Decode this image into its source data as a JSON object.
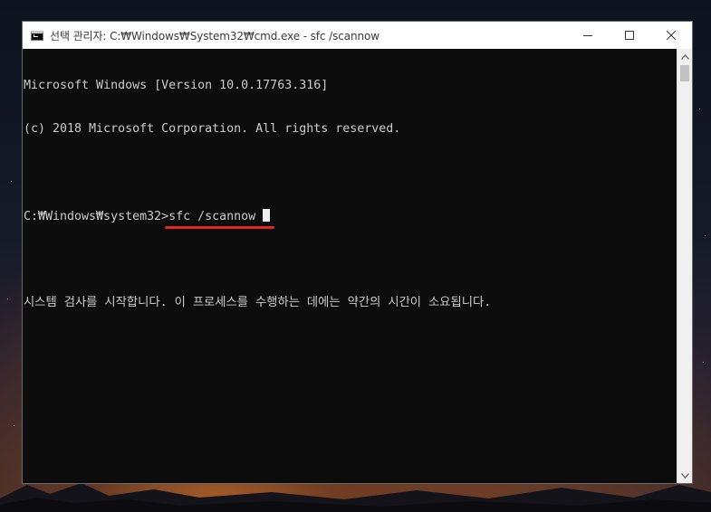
{
  "window": {
    "title": "선택 관리자: C:₩Windows₩System32₩cmd.exe - sfc  /scannow",
    "icon": "cmd-icon",
    "controls": {
      "minimize_icon": "minimize-icon",
      "maximize_icon": "maximize-icon",
      "close_icon": "close-icon"
    }
  },
  "console": {
    "lines": [
      "Microsoft Windows [Version 10.0.17763.316]",
      "(c) 2018 Microsoft Corporation. All rights reserved.",
      ""
    ],
    "prompt": "C:₩Windows₩system32>",
    "command": "sfc /scannow ",
    "output": "시스템 검사를 시작합니다. 이 프로세스를 수행하는 데에는 약간의 시간이 소요됩니다.",
    "text_color": "#cccccc",
    "background_color": "#0c0c0c",
    "highlight_color": "#e3242b"
  },
  "scrollbar": {
    "up_icon": "chevron-up-icon",
    "down_icon": "chevron-down-icon"
  }
}
